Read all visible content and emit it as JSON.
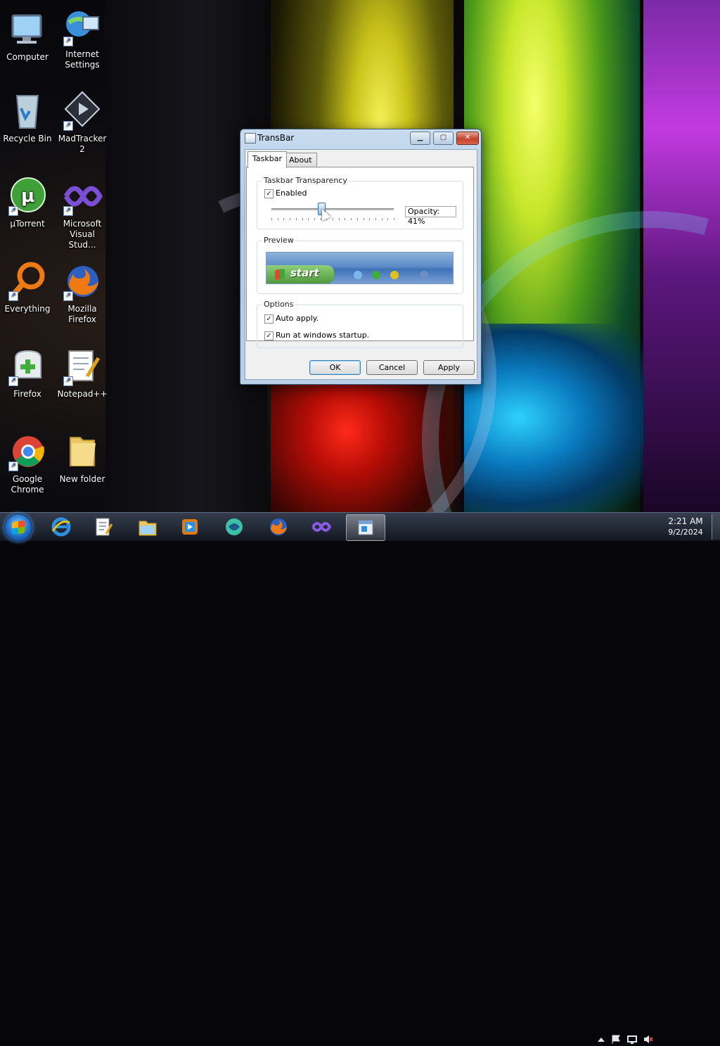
{
  "desktop": {
    "icons": [
      {
        "label": "Computer",
        "icon": "computer-icon"
      },
      {
        "label": "Internet Settings",
        "icon": "internet-settings-icon"
      },
      {
        "label": "Recycle Bin",
        "icon": "recycle-bin-icon"
      },
      {
        "label": "MadTracker 2",
        "icon": "madtracker-icon"
      },
      {
        "label": "µTorrent",
        "icon": "utorrent-icon"
      },
      {
        "label": "Microsoft Visual Stud...",
        "icon": "visual-studio-icon"
      },
      {
        "label": "Everything",
        "icon": "everything-search-icon"
      },
      {
        "label": "Mozilla Firefox",
        "icon": "firefox-icon"
      },
      {
        "label": "Firefox",
        "icon": "firefox-profile-icon"
      },
      {
        "label": "Notepad++",
        "icon": "notepadpp-icon"
      },
      {
        "label": "Google Chrome",
        "icon": "chrome-icon"
      },
      {
        "label": "New folder",
        "icon": "folder-icon"
      }
    ]
  },
  "dialog": {
    "title": "TransBar",
    "tabs": [
      {
        "label": "Taskbar",
        "active": true
      },
      {
        "label": "About",
        "active": false
      }
    ],
    "transparency_group": {
      "label": "Taskbar Transparency",
      "enabled_label": "Enabled",
      "enabled_checked": true,
      "opacity_text": "Opacity: 41%",
      "opacity_value": 41
    },
    "preview_group": {
      "label": "Preview",
      "start_text": "start"
    },
    "options_group": {
      "label": "Options",
      "auto_apply_label": "Auto apply.",
      "auto_apply_checked": true,
      "startup_label": "Run at windows startup.",
      "startup_checked": true
    },
    "buttons": {
      "ok": "OK",
      "cancel": "Cancel",
      "apply": "Apply"
    }
  },
  "taskbar": {
    "pinned": [
      "internet-explorer-icon",
      "notepadpp-icon",
      "explorer-icon",
      "media-icon",
      "transbar-app-icon",
      "firefox-icon",
      "visual-studio-icon",
      "transbar-window-icon"
    ],
    "clock": {
      "time": "2:21 AM",
      "date": "9/2/2024"
    }
  },
  "colors": {
    "accent": "#3c7fb1",
    "close": "#c4432b"
  }
}
